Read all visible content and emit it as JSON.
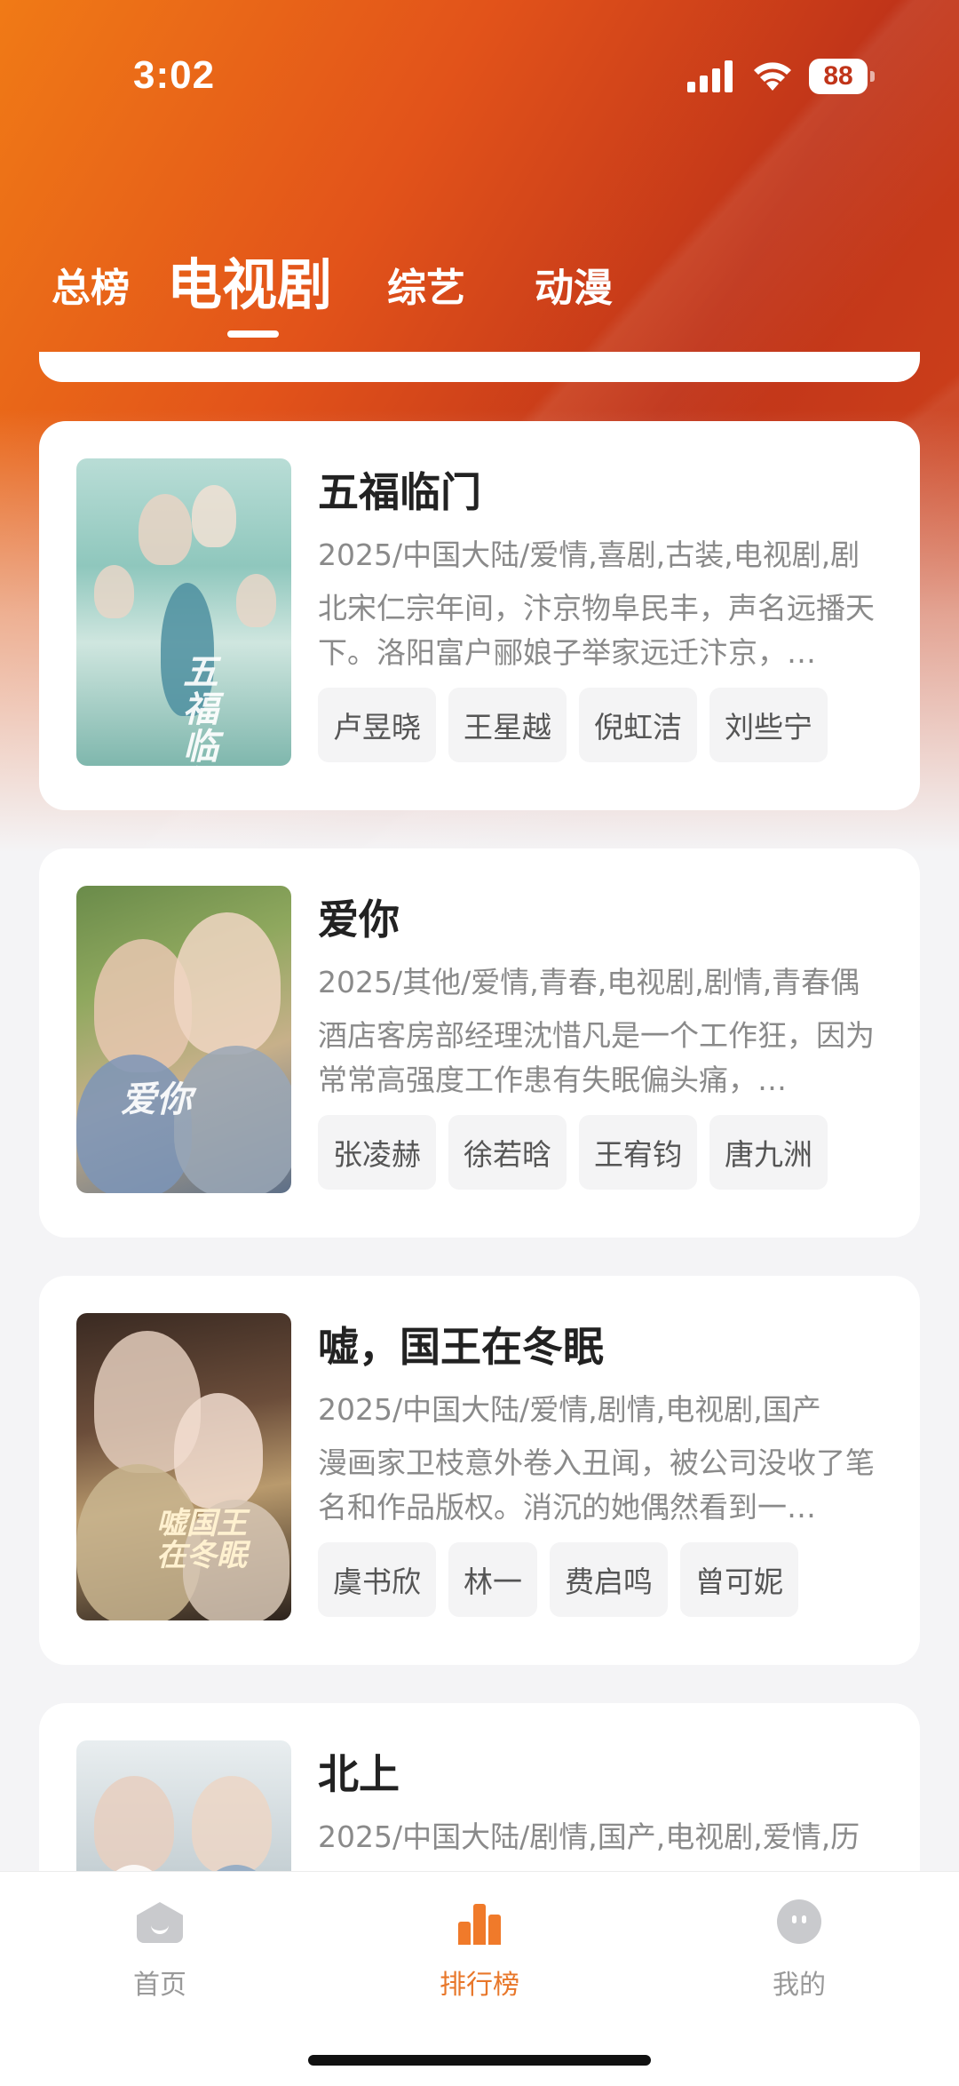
{
  "status_bar": {
    "time": "3:02",
    "battery": "88"
  },
  "top_tabs": [
    {
      "label": "总榜"
    },
    {
      "label": "电视剧",
      "active": true
    },
    {
      "label": "综艺"
    },
    {
      "label": "动漫"
    }
  ],
  "shows": [
    {
      "title": "五福临门",
      "meta": "2025/中国大陆/爱情,喜剧,古装,电视剧,剧",
      "desc": "北宋仁宗年间，汴京物阜民丰，声名远播天下。洛阳富户郦娘子举家远迁汴京，…",
      "cast": [
        "卢昱晓",
        "王星越",
        "倪虹洁",
        "刘些宁"
      ],
      "poster_text": "五福临门"
    },
    {
      "title": "爱你",
      "meta": "2025/其他/爱情,青春,电视剧,剧情,青春偶",
      "desc": "酒店客房部经理沈惜凡是一个工作狂，因为常常高强度工作患有失眠偏头痛，…",
      "cast": [
        "张凌赫",
        "徐若晗",
        "王宥钧",
        "唐九洲"
      ],
      "poster_text": "爱你"
    },
    {
      "title": "嘘，国王在冬眠",
      "meta": "2025/中国大陆/爱情,剧情,电视剧,国产",
      "desc": "漫画家卫枝意外卷入丑闻，被公司没收了笔名和作品版权。消沉的她偶然看到一…",
      "cast": [
        "虞书欣",
        "林一",
        "费启鸣",
        "曾可妮"
      ],
      "poster_text": "嘘国王在冬眠"
    },
    {
      "title": "北上",
      "meta": "2025/中国大陆/剧情,国产,电视剧,爱情,历",
      "desc": "",
      "cast": [],
      "poster_text": ""
    }
  ],
  "bottom_nav": [
    {
      "label": "首页",
      "icon": "home-icon"
    },
    {
      "label": "排行榜",
      "icon": "ranking-icon",
      "active": true
    },
    {
      "label": "我的",
      "icon": "profile-icon"
    }
  ],
  "colors": {
    "accent": "#e8772a",
    "hero_start": "#f07a16",
    "hero_end": "#c03419"
  }
}
